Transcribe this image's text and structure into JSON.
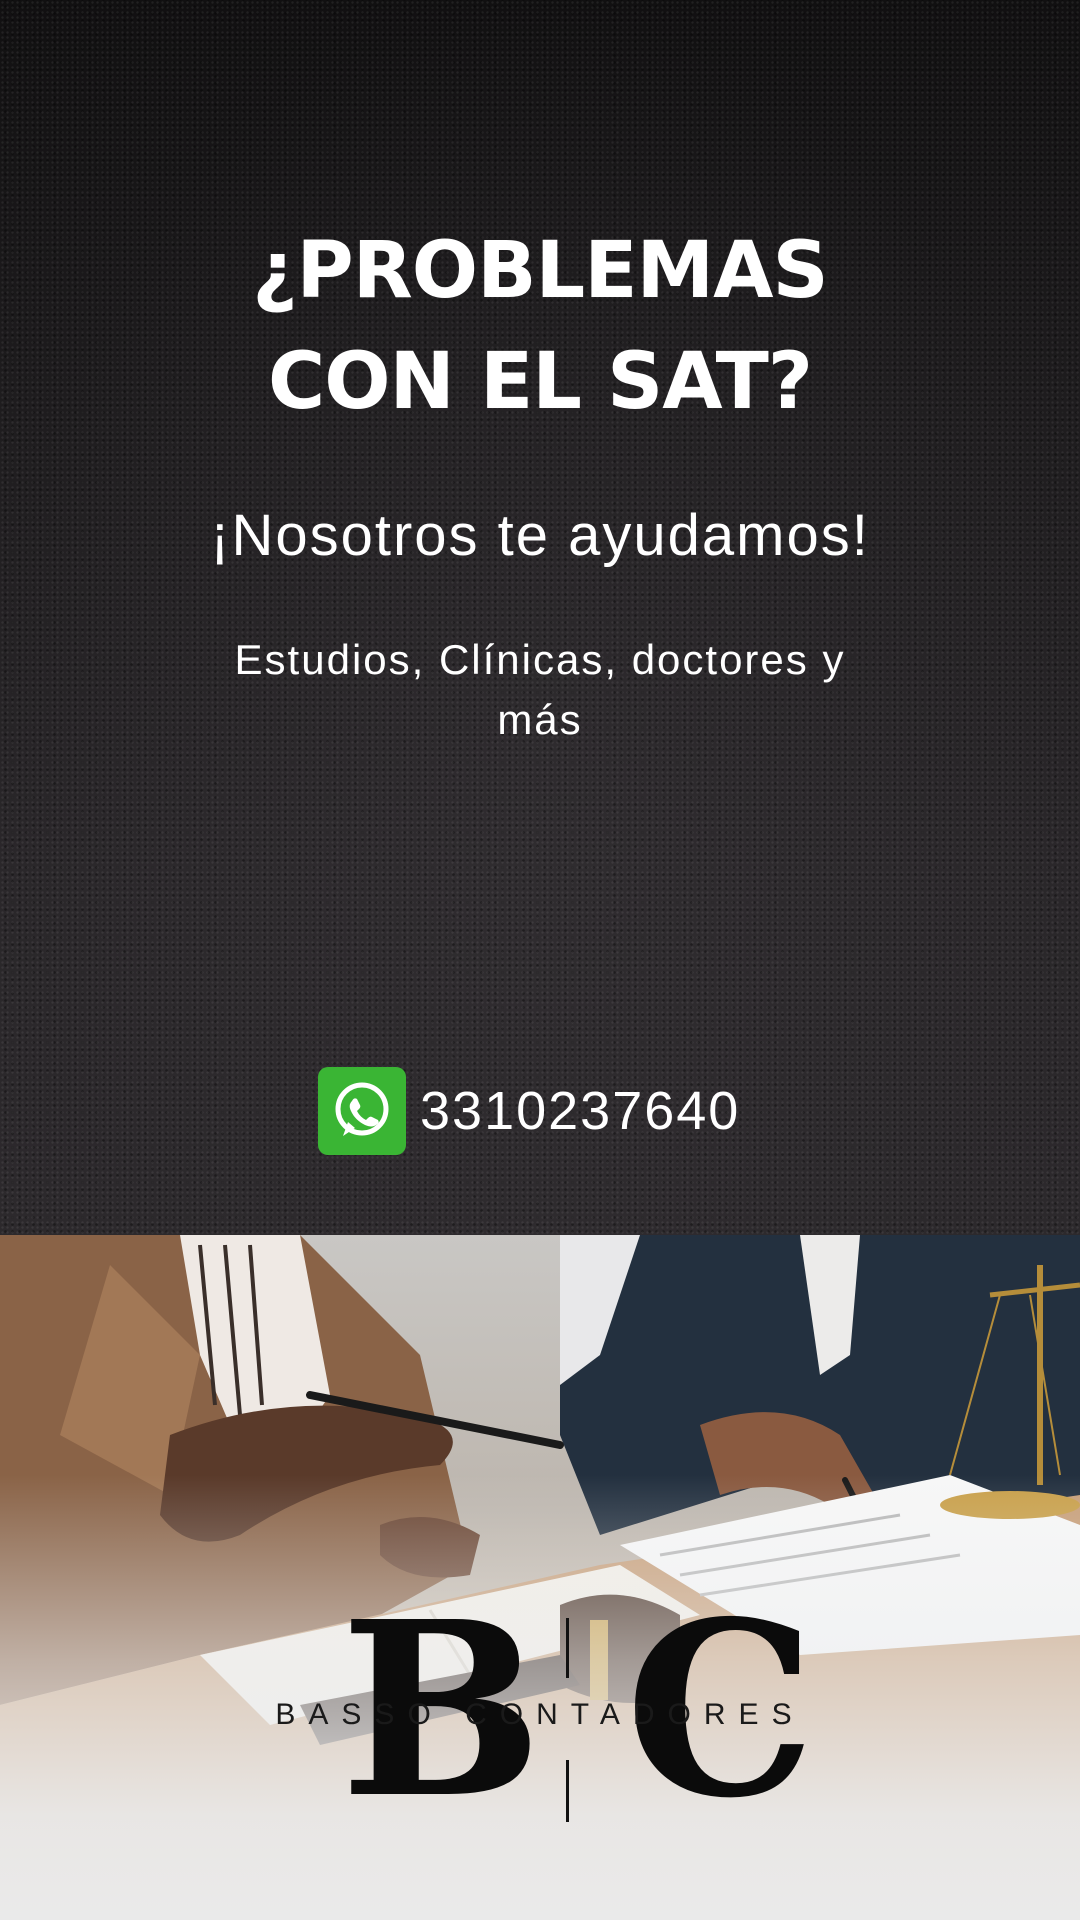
{
  "headline": {
    "line1": "¿PROBLEMAS",
    "line2": "CON EL SAT?"
  },
  "subheadline": "¡Nosotros te ayudamos!",
  "services": "Estudios, Clínicas, doctores y más",
  "contact": {
    "icon": "whatsapp-icon",
    "phone": "3310237640",
    "icon_color": "#3ab534"
  },
  "logo": {
    "monogram_left": "B",
    "monogram_right": "C",
    "name": "BASSO CONTADORES"
  }
}
